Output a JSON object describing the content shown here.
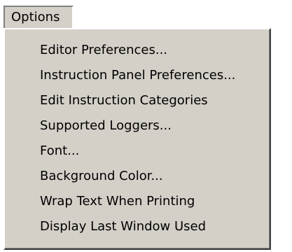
{
  "menubar": {
    "title": "Options"
  },
  "menu": {
    "items": [
      {
        "label": "Editor Preferences..."
      },
      {
        "label": "Instruction Panel Preferences..."
      },
      {
        "label": "Edit Instruction Categories"
      },
      {
        "label": "Supported Loggers..."
      },
      {
        "label": "Font..."
      },
      {
        "label": "Background Color..."
      },
      {
        "label": "Wrap Text When Printing"
      },
      {
        "label": "Display Last Window Used"
      }
    ]
  }
}
